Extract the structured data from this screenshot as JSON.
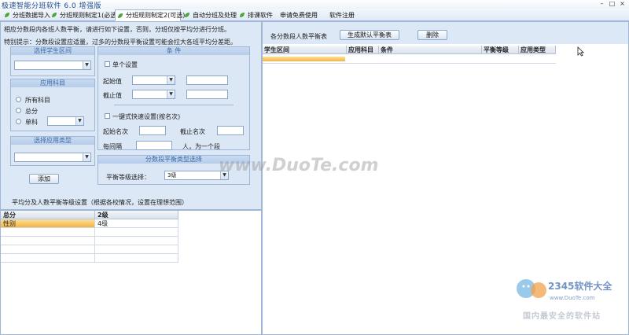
{
  "window": {
    "title": "极速智能分班软件 6.0 增强版",
    "controls": [
      "–",
      "□",
      "×"
    ]
  },
  "tabs": [
    {
      "label": "分班数据导入",
      "active": false
    },
    {
      "label": "分班规则制定1(必选)",
      "active": false
    },
    {
      "label": "分班规则制定2(可选)",
      "active": true
    },
    {
      "label": "自动分班及处理",
      "active": false
    },
    {
      "label": "排课软件",
      "active": false
    },
    {
      "label": "申请免费使用",
      "active": false
    },
    {
      "label": "软件注册",
      "active": false
    }
  ],
  "left": {
    "intro": "相应分数段内各班人数平衡，请进行如下设置，否则，分班仅按平均分进行分班。",
    "tip": "特别提示：分数段设置应适量，过多的分数段平衡设置可能会拉大各班平均分差距。",
    "student_range": {
      "title": "选择学生区间",
      "value": ""
    },
    "subject": {
      "title": "应用科目",
      "options": [
        "所有科目",
        "总分",
        "单科"
      ],
      "single_value": ""
    },
    "apply_type": {
      "title": "选择应用类型",
      "value": ""
    },
    "add_button": "添加",
    "conditions": {
      "title": "条 件",
      "single_setting": "单个设置",
      "start_value": "起始值",
      "end_value": "截止值",
      "quick_setting": "一键式快速设置(按名次)",
      "start_rank": "起始名次",
      "end_rank": "截止名次",
      "interval": "每间隔",
      "interval_suffix": "人，为一个段"
    },
    "balance_type": {
      "title": "分数段平衡类型选择",
      "label": "平衡等级选择：",
      "value": "3级"
    },
    "footer_note": "平均分及人数平衡等级设置（根据各校情况，设置在理想范围）"
  },
  "grid_bottom": {
    "columns": [
      "总分",
      "2级"
    ],
    "rows": [
      [
        "性别",
        "4级"
      ],
      [
        "",
        ""
      ],
      [
        "",
        ""
      ],
      [
        "",
        ""
      ],
      [
        "",
        ""
      ]
    ]
  },
  "right": {
    "title": "各分数段人数平衡表",
    "generate_button": "生成默认平衡表",
    "delete_button": "删除",
    "columns": [
      "学生区间",
      "应用科目",
      "条件",
      "平衡等级",
      "应用类型"
    ]
  },
  "watermarks": {
    "center": "www.DuoTe.com",
    "logo": "2345软件大全",
    "logo_url": "www.DuoTe.com",
    "logo_sub": "国内最安全的软件站"
  },
  "colors": {
    "accent": "#1f4e8c",
    "panel": "#dce8f5",
    "selected_row": "#f7c86b"
  }
}
